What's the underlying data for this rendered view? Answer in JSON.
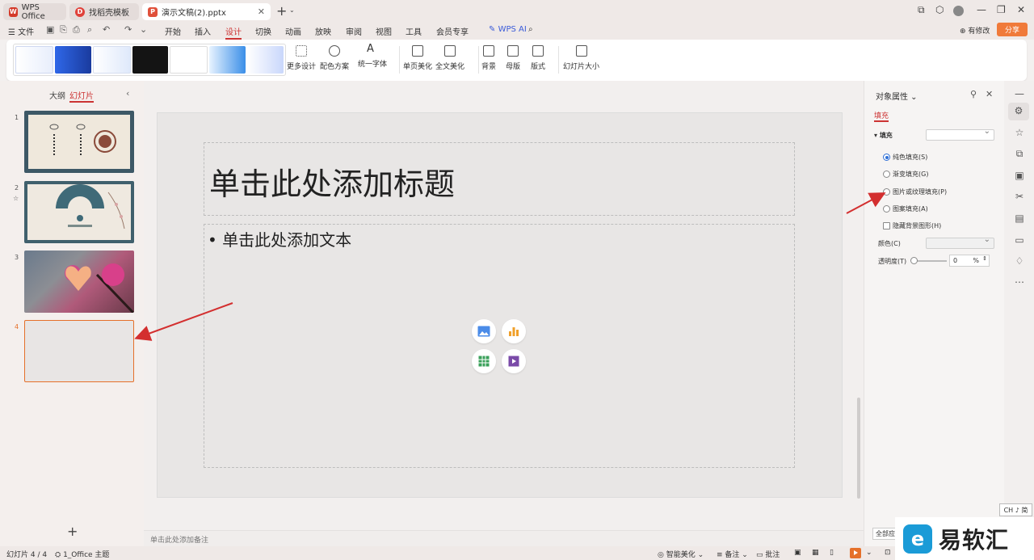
{
  "tabs": [
    {
      "label": "WPS Office"
    },
    {
      "label": "找稻壳模板"
    },
    {
      "label": "演示文稿(2).pptx"
    }
  ],
  "menu": {
    "file": "文件",
    "items": [
      "开始",
      "插入",
      "设计",
      "切换",
      "动画",
      "放映",
      "审阅",
      "视图",
      "工具",
      "会员专享"
    ],
    "active": "设计",
    "wps_ai": "WPS AI",
    "revise": "有修改",
    "share": "分享"
  },
  "ribbon": {
    "more_design": "更多设计",
    "color_scheme": "配色方案",
    "unify_font": "统一字体",
    "page_beautify": "单页美化",
    "full_beautify": "全文美化",
    "background": "背景",
    "master": "母版",
    "layout": "版式",
    "slide_size": "幻灯片大小"
  },
  "left_panel": {
    "tab_outline": "大纲",
    "tab_slides": "幻灯片",
    "slides": [
      {
        "num": "1"
      },
      {
        "num": "2"
      },
      {
        "num": "3"
      },
      {
        "num": "4"
      }
    ]
  },
  "slide": {
    "title_placeholder": "单击此处添加标题",
    "body_placeholder": "• 单击此处添加文本",
    "notes_placeholder": "单击此处添加备注"
  },
  "properties": {
    "title": "对象属性",
    "tab": "填充",
    "section": "填充",
    "options": [
      {
        "label": "纯色填充(S)",
        "selected": true
      },
      {
        "label": "渐变填充(G)",
        "selected": false
      },
      {
        "label": "图片或纹理填充(P)",
        "selected": false
      },
      {
        "label": "图案填充(A)",
        "selected": false
      }
    ],
    "hide_bg": "隐藏背景图形(H)",
    "color_label": "颜色(C)",
    "transparency_label": "透明度(T)",
    "transparency_value": "0",
    "transparency_unit": "%",
    "apply_all": "全部应用"
  },
  "statusbar": {
    "slide_count": "幻灯片 4 / 4",
    "theme": "1_Office 主题",
    "smart_beautify": "智能美化",
    "notes": "备注",
    "comments": "批注"
  },
  "ime": "CH ♪ 简",
  "watermark": {
    "text": "易软汇",
    "logo": "e"
  },
  "colors": {
    "accent": "#c33333",
    "orange": "#e5702a",
    "arrow": "#d32f2f"
  }
}
